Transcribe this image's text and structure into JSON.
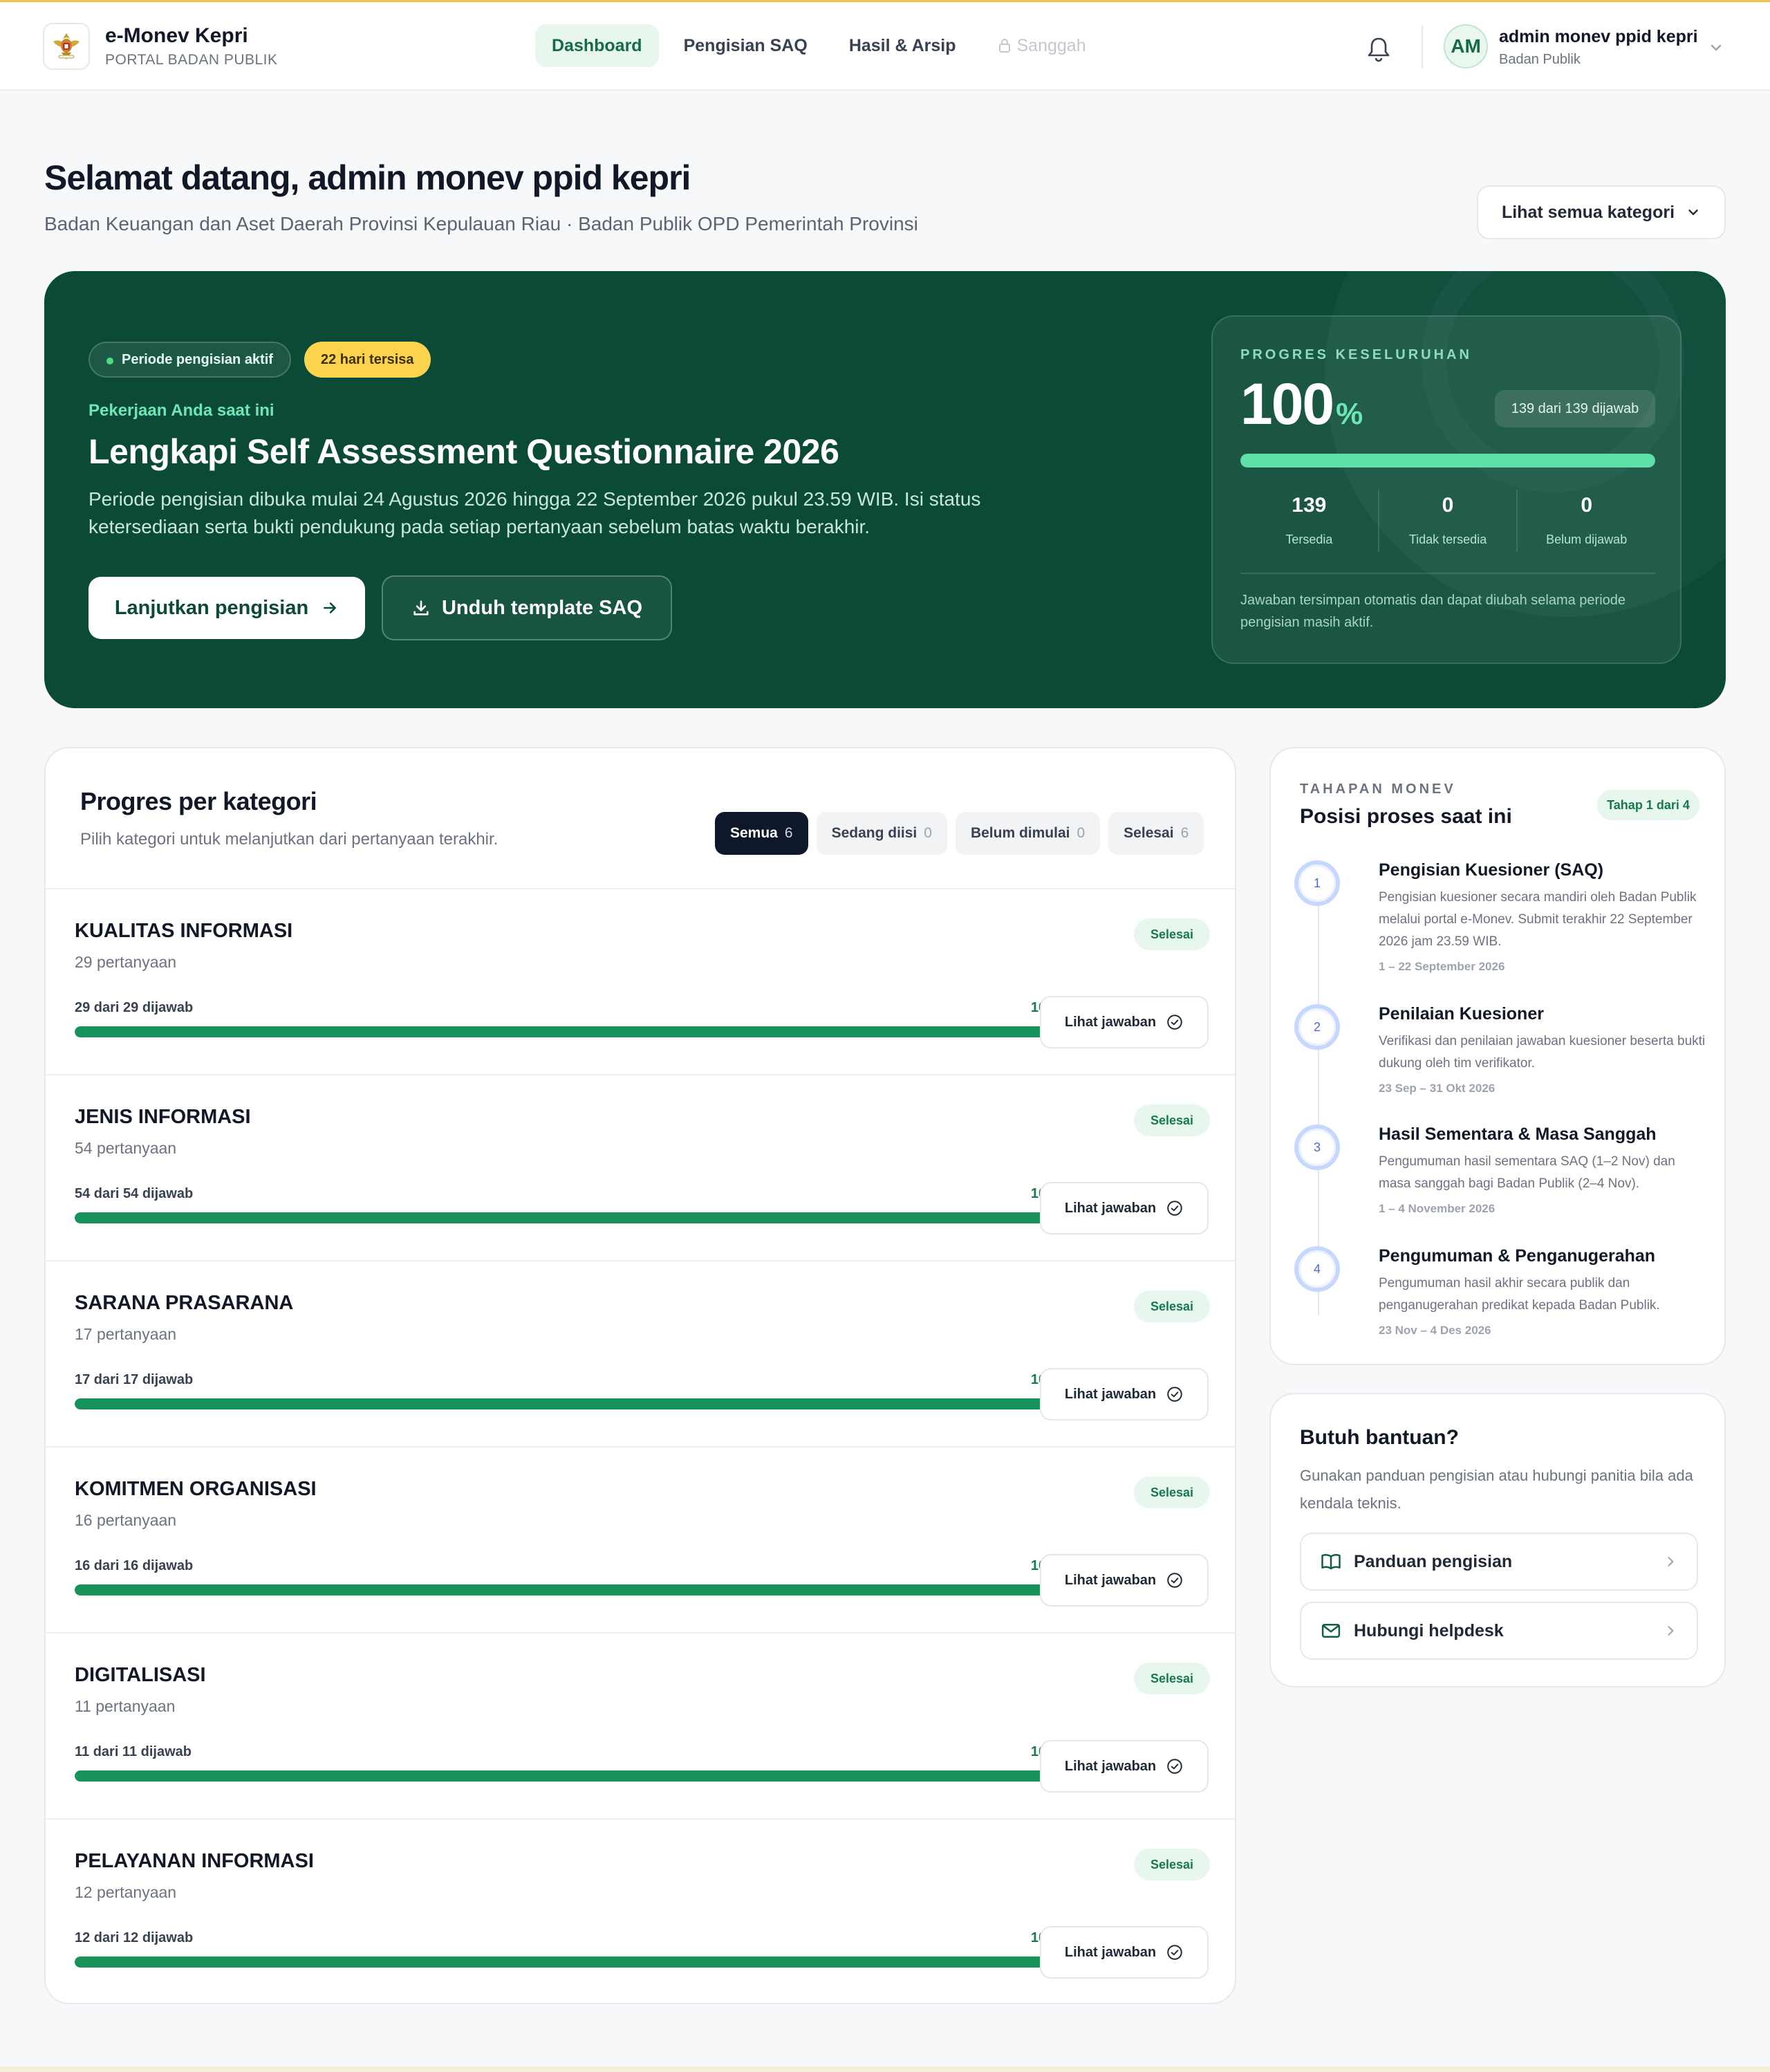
{
  "header": {
    "brand_title": "e-Monev Kepri",
    "brand_subtitle": "PORTAL BADAN PUBLIK",
    "nav": [
      {
        "label": "Dashboard",
        "active": true
      },
      {
        "label": "Pengisian SAQ"
      },
      {
        "label": "Hasil & Arsip"
      },
      {
        "label": "Sanggah",
        "disabled": true
      }
    ],
    "user": {
      "initials": "AM",
      "name": "admin monev ppid kepri",
      "role": "Badan Publik"
    }
  },
  "welcome": {
    "title": "Selamat datang, admin monev ppid kepri",
    "subtitle": "Badan Keuangan dan Aset Daerah Provinsi Kepulauan Riau · Badan Publik OPD Pemerintah Provinsi",
    "category_button": "Lihat semua kategori"
  },
  "hero": {
    "pill_active": "Periode pengisian aktif",
    "pill_days": "22 hari tersisa",
    "kicker": "Pekerjaan Anda saat ini",
    "title": "Lengkapi Self Assessment Questionnaire 2026",
    "description": "Periode pengisian dibuka mulai 24 Agustus 2026 hingga 22 September 2026 pukul 23.59 WIB. Isi status ketersediaan serta bukti pendukung pada setiap pertanyaan sebelum batas waktu berakhir.",
    "primary_button": "Lanjutkan pengisian",
    "secondary_button": "Unduh template SAQ",
    "progress": {
      "label": "PROGRES KESELURUHAN",
      "percent": "100",
      "percent_symbol": "%",
      "percent_value": 100,
      "badge": "139 dari 139 dijawab",
      "stats": [
        {
          "value": "139",
          "label": "Tersedia"
        },
        {
          "value": "0",
          "label": "Tidak tersedia"
        },
        {
          "value": "0",
          "label": "Belum dijawab"
        }
      ],
      "note": "Jawaban tersimpan otomatis dan dapat diubah selama periode pengisian masih aktif."
    }
  },
  "categories": {
    "title": "Progres per kategori",
    "subtitle": "Pilih kategori untuk melanjutkan dari pertanyaan terakhir.",
    "filters": [
      {
        "label": "Semua",
        "count": "6",
        "active": true
      },
      {
        "label": "Sedang diisi",
        "count": "0"
      },
      {
        "label": "Belum dimulai",
        "count": "0"
      },
      {
        "label": "Selesai",
        "count": "6"
      }
    ],
    "view_button": "Lihat jawaban",
    "items": [
      {
        "name": "KUALITAS INFORMASI",
        "count": "29 pertanyaan",
        "badge": "Selesai",
        "answered": "29 dari 29 dijawab",
        "percent": "100%",
        "value": 100
      },
      {
        "name": "JENIS INFORMASI",
        "count": "54 pertanyaan",
        "badge": "Selesai",
        "answered": "54 dari 54 dijawab",
        "percent": "100%",
        "value": 100
      },
      {
        "name": "SARANA PRASARANA",
        "count": "17 pertanyaan",
        "badge": "Selesai",
        "answered": "17 dari 17 dijawab",
        "percent": "100%",
        "value": 100
      },
      {
        "name": "KOMITMEN ORGANISASI",
        "count": "16 pertanyaan",
        "badge": "Selesai",
        "answered": "16 dari 16 dijawab",
        "percent": "100%",
        "value": 100
      },
      {
        "name": "DIGITALISASI",
        "count": "11 pertanyaan",
        "badge": "Selesai",
        "answered": "11 dari 11 dijawab",
        "percent": "100%",
        "value": 100
      },
      {
        "name": "PELAYANAN INFORMASI",
        "count": "12 pertanyaan",
        "badge": "Selesai",
        "answered": "12 dari 12 dijawab",
        "percent": "100%",
        "value": 100
      }
    ]
  },
  "timeline": {
    "label": "TAHAPAN MONEV",
    "title": "Posisi proses saat ini",
    "badge": "Tahap 1 dari 4",
    "steps": [
      {
        "number": "1",
        "title": "Pengisian Kuesioner (SAQ)",
        "description": "Pengisian kuesioner secara mandiri oleh Badan Publik melalui portal e-Monev. Submit terakhir 22 September 2026 jam 23.59 WIB.",
        "date": "1 – 22 September 2026"
      },
      {
        "number": "2",
        "title": "Penilaian Kuesioner",
        "description": "Verifikasi dan penilaian jawaban kuesioner beserta bukti dukung oleh tim verifikator.",
        "date": "23 Sep – 31 Okt 2026"
      },
      {
        "number": "3",
        "title": "Hasil Sementara & Masa Sanggah",
        "description": "Pengumuman hasil sementara SAQ (1–2 Nov) dan masa sanggah bagi Badan Publik (2–4 Nov).",
        "date": "1 – 4 November 2026"
      },
      {
        "number": "4",
        "title": "Pengumuman & Penganugerahan",
        "description": "Pengumuman hasil akhir secara publik dan penganugerahan predikat kepada Badan Publik.",
        "date": "23 Nov – 4 Des 2026"
      }
    ]
  },
  "help": {
    "title": "Butuh bantuan?",
    "description": "Gunakan panduan pengisian atau hubungi panitia bila ada kendala teknis.",
    "links": [
      {
        "label": "Panduan pengisian",
        "icon": "book-icon"
      },
      {
        "label": "Hubungi helpdesk",
        "icon": "mail-icon"
      }
    ]
  }
}
